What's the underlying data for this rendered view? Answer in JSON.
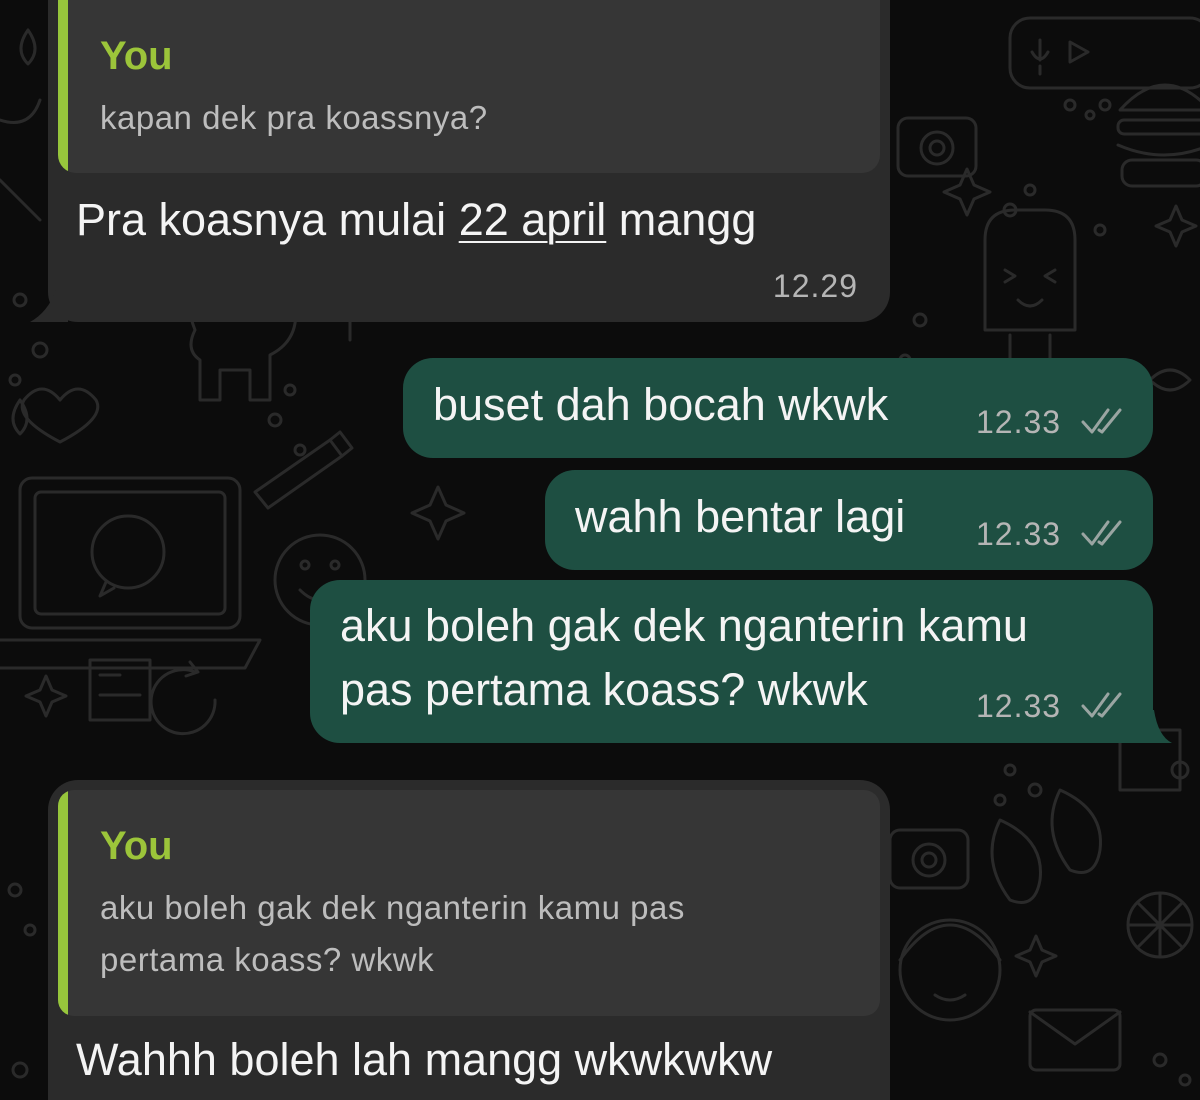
{
  "colors": {
    "background": "#0c0c0c",
    "incoming_bubble": "#2b2b2b",
    "outgoing_bubble": "#1e4f42",
    "quote_bubble": "#363636",
    "quote_accent": "#97c63c",
    "quote_author": "#9cc53a",
    "timestamp": "#b5b5b5"
  },
  "messages": [
    {
      "direction": "incoming",
      "reply_to": {
        "author": "You",
        "text": "kapan dek pra koassnya?"
      },
      "text_before": "Pra koasnya mulai ",
      "text_link": "22 april",
      "text_after": " mangg",
      "time": "12.29"
    },
    {
      "direction": "outgoing",
      "text": "buset dah bocah wkwk",
      "time": "12.33",
      "status_icon": "double-check-icon"
    },
    {
      "direction": "outgoing",
      "text": "wahh bentar lagi",
      "time": "12.33",
      "status_icon": "double-check-icon"
    },
    {
      "direction": "outgoing",
      "line1": "aku boleh gak dek nganterin kamu",
      "line2": "pas pertama koass? wkwk",
      "time": "12.33",
      "status_icon": "double-check-icon"
    },
    {
      "direction": "incoming",
      "reply_to": {
        "author": "You",
        "line1": "aku boleh gak dek nganterin kamu pas",
        "line2": "pertama koass? wkwk"
      },
      "text": "Wahhh boleh lah mangg wkwkwkw"
    }
  ]
}
